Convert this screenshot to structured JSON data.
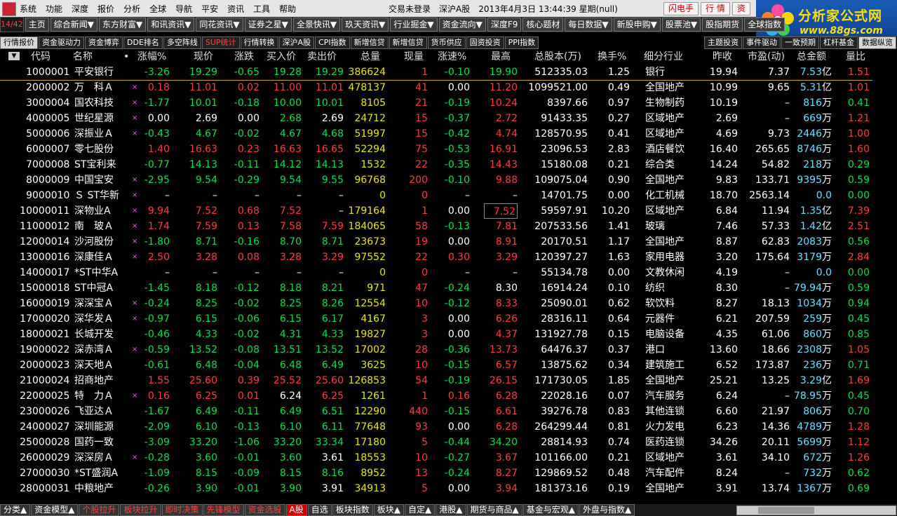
{
  "menu": [
    "系统",
    "功能",
    "深度",
    "报价",
    "分析",
    "全球",
    "导航",
    "平安",
    "资讯",
    "工具",
    "帮助"
  ],
  "status": {
    "trade": "交易未登录",
    "market": "深沪A股",
    "datetime": "2013年4月3日 13:44:39 星期(null)"
  },
  "topbuttons": [
    "闪电手",
    "行 情",
    "资"
  ],
  "logo": {
    "brand": "分析家公式网",
    "site": "www.88gs.com"
  },
  "page_indicator": "14/42",
  "nav": [
    "主页",
    "综合新闻▼",
    "东方财富▼",
    "和讯资讯▼",
    "同花资讯▼",
    "证券之星▼",
    "全景快讯▼",
    "玖天资讯▼",
    "行业掘金▼",
    "资金流向▼",
    "深度F9",
    "核心题材",
    "每日数据▼",
    "新股申购▼",
    "股票池▼",
    "股指期货",
    "全球指数"
  ],
  "tabs": [
    "行情报价",
    "资金驱动力",
    "资金博弈",
    "DDE排名",
    "多空阵线",
    "SUP统计",
    "行情转换",
    "深沪A股",
    "CPI指数",
    "新增信贷",
    "新增信贷",
    "货币供应",
    "固资投资",
    "PPI指数"
  ],
  "right_tabs": [
    "主题投资",
    "事件驱动",
    "一致预期",
    "杠杆基金",
    "数据纵览"
  ],
  "headers": [
    "代码",
    "名称",
    "•",
    "涨幅%",
    "现价",
    "涨跌",
    "买入价",
    "卖出价",
    "总量",
    "现量",
    "涨速%",
    "最高",
    "总股本(万)",
    "换手%",
    "细分行业",
    "昨收",
    "市盈(动)",
    "总金额",
    "量比"
  ],
  "rows": [
    [
      "1",
      "000001",
      "平安银行",
      "",
      "-3.26",
      "19.29",
      "-0.65",
      "19.28",
      "19.29",
      "386624",
      "1",
      "-0.10",
      "19.90",
      "512335.03",
      "1.25",
      "银行",
      "19.94",
      "7.37",
      "7.53",
      "亿",
      "1.51"
    ],
    [
      "2",
      "000002",
      "万　科Ａ",
      "×",
      "0.18",
      "11.01",
      "0.02",
      "11.00",
      "11.01",
      "478137",
      "41",
      "0.00",
      "11.20",
      "1099521.00",
      "0.49",
      "全国地产",
      "10.99",
      "9.65",
      "5.31",
      "亿",
      "1.01"
    ],
    [
      "3",
      "000004",
      "国农科技",
      "×",
      "-1.77",
      "10.01",
      "-0.18",
      "10.00",
      "10.01",
      "8105",
      "21",
      "-0.19",
      "10.24",
      "8397.66",
      "0.97",
      "生物制药",
      "10.19",
      "–",
      "816",
      "万",
      "0.41"
    ],
    [
      "4",
      "000005",
      "世纪星源",
      "×",
      "0.00",
      "2.69",
      "0.00",
      "2.68",
      "2.69",
      "24712",
      "15",
      "-0.37",
      "2.72",
      "91433.35",
      "0.27",
      "区域地产",
      "2.69",
      "–",
      "669",
      "万",
      "1.21"
    ],
    [
      "5",
      "000006",
      "深振业Ａ",
      "×",
      "-0.43",
      "4.67",
      "-0.02",
      "4.67",
      "4.68",
      "51997",
      "15",
      "-0.42",
      "4.74",
      "128570.95",
      "0.41",
      "区域地产",
      "4.69",
      "9.73",
      "2446",
      "万",
      "1.00"
    ],
    [
      "6",
      "000007",
      "零七股份",
      "",
      "1.40",
      "16.63",
      "0.23",
      "16.63",
      "16.65",
      "52294",
      "75",
      "-0.53",
      "16.91",
      "23096.53",
      "2.83",
      "酒店餐饮",
      "16.40",
      "265.65",
      "8746",
      "万",
      "1.60"
    ],
    [
      "7",
      "000008",
      "ST宝利来",
      "",
      "-0.77",
      "14.13",
      "-0.11",
      "14.12",
      "14.13",
      "1532",
      "22",
      "-0.35",
      "14.43",
      "15180.08",
      "0.21",
      "综合类",
      "14.24",
      "54.82",
      "218",
      "万",
      "0.29"
    ],
    [
      "8",
      "000009",
      "中国宝安",
      "×",
      "-2.95",
      "9.54",
      "-0.29",
      "9.54",
      "9.55",
      "96768",
      "200",
      "-0.10",
      "9.88",
      "109075.04",
      "0.90",
      "全国地产",
      "9.83",
      "133.71",
      "9395",
      "万",
      "0.59"
    ],
    [
      "9",
      "000010",
      "Ｓ ST华新",
      "×",
      "–",
      "–",
      "–",
      "–",
      "–",
      "0",
      "0",
      "–",
      "–",
      "14701.75",
      "0.00",
      "化工机械",
      "18.70",
      "2563.14",
      "0.0",
      "",
      "0.00"
    ],
    [
      "10",
      "000011",
      "深物业A",
      "×",
      "9.94",
      "7.52",
      "0.68",
      "7.52",
      "–",
      "179164",
      "1",
      "0.00",
      "7.52",
      "59597.91",
      "10.20",
      "区域地产",
      "6.84",
      "11.94",
      "1.35",
      "亿",
      "7.39"
    ],
    [
      "11",
      "000012",
      "南　玻Ａ",
      "×",
      "1.74",
      "7.59",
      "0.13",
      "7.58",
      "7.59",
      "184065",
      "58",
      "-0.13",
      "7.81",
      "207533.56",
      "1.41",
      "玻璃",
      "7.46",
      "57.33",
      "1.42",
      "亿",
      "2.51"
    ],
    [
      "12",
      "000014",
      "沙河股份",
      "×",
      "-1.80",
      "8.71",
      "-0.16",
      "8.70",
      "8.71",
      "23673",
      "19",
      "0.00",
      "8.91",
      "20170.51",
      "1.17",
      "全国地产",
      "8.87",
      "62.83",
      "2083",
      "万",
      "0.56"
    ],
    [
      "13",
      "000016",
      "深康佳Ａ",
      "×",
      "2.50",
      "3.28",
      "0.08",
      "3.28",
      "3.29",
      "97552",
      "22",
      "0.30",
      "3.29",
      "120397.27",
      "1.63",
      "家用电器",
      "3.20",
      "175.64",
      "3179",
      "万",
      "2.84"
    ],
    [
      "14",
      "000017",
      "*ST中华A",
      "",
      "–",
      "–",
      "–",
      "–",
      "–",
      "0",
      "0",
      "–",
      "–",
      "55134.78",
      "0.00",
      "文教休闲",
      "4.19",
      "–",
      "0.0",
      "",
      "0.00"
    ],
    [
      "15",
      "000018",
      "ST中冠A",
      "",
      "-1.45",
      "8.18",
      "-0.12",
      "8.18",
      "8.21",
      "971",
      "47",
      "-0.24",
      "8.30",
      "16914.24",
      "0.10",
      "纺织",
      "8.30",
      "–",
      "79.94",
      "万",
      "0.59"
    ],
    [
      "16",
      "000019",
      "深深宝Ａ",
      "×",
      "-0.24",
      "8.25",
      "-0.02",
      "8.25",
      "8.26",
      "12554",
      "10",
      "-0.12",
      "8.33",
      "25090.01",
      "0.62",
      "软饮料",
      "8.27",
      "18.13",
      "1034",
      "万",
      "0.94"
    ],
    [
      "17",
      "000020",
      "深华发Ａ",
      "×",
      "-0.97",
      "6.15",
      "-0.06",
      "6.15",
      "6.17",
      "4167",
      "3",
      "0.00",
      "6.26",
      "28316.11",
      "0.64",
      "元器件",
      "6.21",
      "207.59",
      "259",
      "万",
      "0.45"
    ],
    [
      "18",
      "000021",
      "长城开发",
      "",
      "-0.46",
      "4.33",
      "-0.02",
      "4.31",
      "4.33",
      "19827",
      "3",
      "0.00",
      "4.37",
      "131927.78",
      "0.15",
      "电脑设备",
      "4.35",
      "61.06",
      "860",
      "万",
      "0.85"
    ],
    [
      "19",
      "000022",
      "深赤湾Ａ",
      "×",
      "-0.59",
      "13.52",
      "-0.08",
      "13.51",
      "13.52",
      "17002",
      "28",
      "-0.36",
      "13.73",
      "64476.37",
      "0.37",
      "港口",
      "13.60",
      "18.66",
      "2308",
      "万",
      "1.05"
    ],
    [
      "20",
      "000023",
      "深天地Ａ",
      "",
      "-0.61",
      "6.48",
      "-0.04",
      "6.48",
      "6.49",
      "3625",
      "10",
      "-0.15",
      "6.57",
      "13875.62",
      "0.34",
      "建筑施工",
      "6.52",
      "173.87",
      "236",
      "万",
      "0.71"
    ],
    [
      "21",
      "000024",
      "招商地产",
      "",
      "1.55",
      "25.60",
      "0.39",
      "25.52",
      "25.60",
      "126853",
      "54",
      "-0.19",
      "26.15",
      "171730.05",
      "1.85",
      "全国地产",
      "25.21",
      "13.25",
      "3.29",
      "亿",
      "1.69"
    ],
    [
      "22",
      "000025",
      "特　力Ａ",
      "×",
      "0.16",
      "6.25",
      "0.01",
      "6.24",
      "6.25",
      "1261",
      "1",
      "0.16",
      "6.28",
      "22028.16",
      "0.07",
      "汽车服务",
      "6.24",
      "–",
      "78.95",
      "万",
      "0.45"
    ],
    [
      "23",
      "000026",
      "飞亚达Ａ",
      "",
      "-1.67",
      "6.49",
      "-0.11",
      "6.49",
      "6.51",
      "12290",
      "440",
      "-0.15",
      "6.61",
      "39276.78",
      "0.83",
      "其他连锁",
      "6.60",
      "21.97",
      "806",
      "万",
      "0.70"
    ],
    [
      "24",
      "000027",
      "深圳能源",
      "",
      "-2.09",
      "6.10",
      "-0.13",
      "6.10",
      "6.11",
      "77648",
      "93",
      "0.00",
      "6.28",
      "264299.44",
      "0.81",
      "火力发电",
      "6.23",
      "14.36",
      "4789",
      "万",
      "1.28"
    ],
    [
      "25",
      "000028",
      "国药一致",
      "",
      "-3.09",
      "33.20",
      "-1.06",
      "33.20",
      "33.34",
      "17180",
      "5",
      "-0.44",
      "34.20",
      "28814.93",
      "0.74",
      "医药连锁",
      "34.26",
      "20.11",
      "5699",
      "万",
      "1.12"
    ],
    [
      "26",
      "000029",
      "深深房Ａ",
      "×",
      "-0.28",
      "3.60",
      "-0.01",
      "3.60",
      "3.61",
      "18553",
      "10",
      "-0.27",
      "3.67",
      "101166.00",
      "0.21",
      "区域地产",
      "3.61",
      "34.10",
      "672",
      "万",
      "1.26"
    ],
    [
      "27",
      "000030",
      "*ST盛润A",
      "",
      "-1.09",
      "8.15",
      "-0.09",
      "8.15",
      "8.16",
      "8952",
      "13",
      "-0.24",
      "8.27",
      "129869.52",
      "0.48",
      "汽车配件",
      "8.24",
      "–",
      "732",
      "万",
      "0.62"
    ],
    [
      "28",
      "000031",
      "中粮地产",
      "",
      "-0.26",
      "3.90",
      "-0.01",
      "3.90",
      "3.91",
      "34913",
      "5",
      "0.00",
      "3.94",
      "181373.16",
      "0.19",
      "全国地产",
      "3.91",
      "13.74",
      "1367",
      "万",
      "0.69"
    ]
  ],
  "bottom_tabs": [
    "分类▲",
    "资金模型▲",
    "个股拉升",
    "板块拉升",
    "即时决策",
    "先锋模型",
    "资金选股",
    "A股",
    "自选",
    "板块指数",
    "板块▲",
    "自定▲",
    "港股▲",
    "期货与商品▲",
    "基金与宏观▲",
    "外盘与指数▲"
  ],
  "colors": {
    "up": "#ff3c3c",
    "down": "#00e050",
    "volume": "#e6e600",
    "amount": "#66e0ff",
    "background": "#000000"
  }
}
